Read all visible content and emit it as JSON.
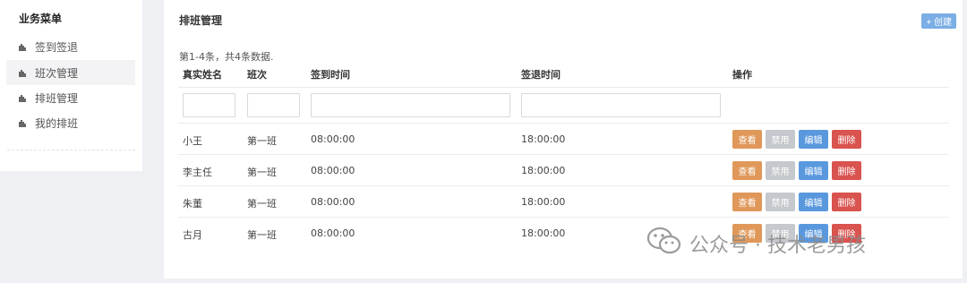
{
  "sidebar": {
    "title": "业务菜单",
    "items": [
      {
        "label": "签到签退",
        "icon": "puzzle-icon"
      },
      {
        "label": "班次管理",
        "icon": "puzzle-icon"
      },
      {
        "label": "排班管理",
        "icon": "puzzle-icon"
      },
      {
        "label": "我的排班",
        "icon": "puzzle-icon"
      }
    ]
  },
  "panel": {
    "title": "排班管理",
    "create_label": "+ 创建",
    "summary": "第1-4条，共4条数据."
  },
  "table": {
    "headers": [
      "真实姓名",
      "班次",
      "签到时间",
      "签退时间",
      "操作"
    ],
    "rows": [
      {
        "name": "小王",
        "shift": "第一班",
        "checkin": "08:00:00",
        "checkout": "18:00:00"
      },
      {
        "name": "李主任",
        "shift": "第一班",
        "checkin": "08:00:00",
        "checkout": "18:00:00"
      },
      {
        "name": "朱董",
        "shift": "第一班",
        "checkin": "08:00:00",
        "checkout": "18:00:00"
      },
      {
        "name": "古月",
        "shift": "第一班",
        "checkin": "08:00:00",
        "checkout": "18:00:00"
      }
    ],
    "actions": {
      "view": "查看",
      "disable": "禁用",
      "edit": "编辑",
      "delete": "删除"
    }
  },
  "watermark": {
    "text": "公众号 · 技术老男孩"
  },
  "colors": {
    "view": "#e0985a",
    "disable": "#c5c8cc",
    "edit": "#5a98de",
    "delete": "#d9534f",
    "create": "#7aaee5"
  }
}
